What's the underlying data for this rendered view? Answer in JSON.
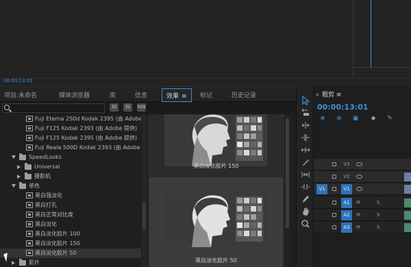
{
  "monitor": {
    "timecode": "00:00:13:01"
  },
  "effects_panel": {
    "tabs": [
      {
        "label": "项目:未命名"
      },
      {
        "label": "媒体浏览器"
      },
      {
        "label": "库"
      },
      {
        "label": "信息"
      },
      {
        "label": "效果",
        "active": true,
        "menu": "≡"
      },
      {
        "label": "标记"
      },
      {
        "label": "历史记录"
      }
    ],
    "search": {
      "placeholder": ""
    },
    "bin_buttons": [
      "32",
      "32",
      "YUV"
    ],
    "tree": [
      {
        "label": "Fuji Eterna 250d Kodak 2395 (由 Adobe 提供)",
        "type": "effect"
      },
      {
        "label": "Fuji F125 Kodak 2393 (由 Adobe 提供)",
        "type": "effect"
      },
      {
        "label": "Fuji F125 Kodak 2395 (由 Adobe 提供)",
        "type": "effect"
      },
      {
        "label": "Fuji Reala 500D Kodak 2393 (由 Adobe 提供)",
        "type": "effect"
      },
      {
        "label": "SpeedLooks",
        "type": "folder-open"
      },
      {
        "label": "Universal",
        "type": "folder-closed"
      },
      {
        "label": "摄影机",
        "type": "folder-closed"
      },
      {
        "label": "单色",
        "type": "folder-open"
      },
      {
        "label": "黑白强淡化",
        "type": "effect"
      },
      {
        "label": "黑白打孔",
        "type": "effect"
      },
      {
        "label": "黑白正常对比度",
        "type": "effect"
      },
      {
        "label": "黑白淡化",
        "type": "effect"
      },
      {
        "label": "黑白淡化胶片 100",
        "type": "effect"
      },
      {
        "label": "黑白淡化胶片 150",
        "type": "effect"
      },
      {
        "label": "黑白淡化胶片 50",
        "type": "effect",
        "selected": true
      },
      {
        "label": "影片",
        "type": "folder-closed"
      }
    ],
    "preview": [
      {
        "caption": "黑白淡化胶片 150"
      },
      {
        "caption": "黑白淡化胶片 50",
        "selected": true
      }
    ]
  },
  "tools": [
    "selection",
    "track-select",
    "ripple-edit",
    "rolling-edit",
    "rate-stretch",
    "razor",
    "slip",
    "slide",
    "pen",
    "hand",
    "zoom"
  ],
  "timeline": {
    "tab": "粗剪",
    "menu": "≡",
    "timecode": "00:00:13:01",
    "tracks": [
      {
        "source": "",
        "target": "V3",
        "kind": "video"
      },
      {
        "source": "",
        "target": "V2",
        "kind": "video"
      },
      {
        "source": "V1",
        "target": "V1",
        "kind": "video"
      },
      {
        "source": "",
        "target": "A1",
        "kind": "audio",
        "m": "M",
        "s": "S"
      },
      {
        "source": "",
        "target": "A2",
        "kind": "audio",
        "m": "M",
        "s": "S"
      },
      {
        "source": "",
        "target": "A3",
        "kind": "audio",
        "m": "M",
        "s": "S"
      }
    ]
  }
}
